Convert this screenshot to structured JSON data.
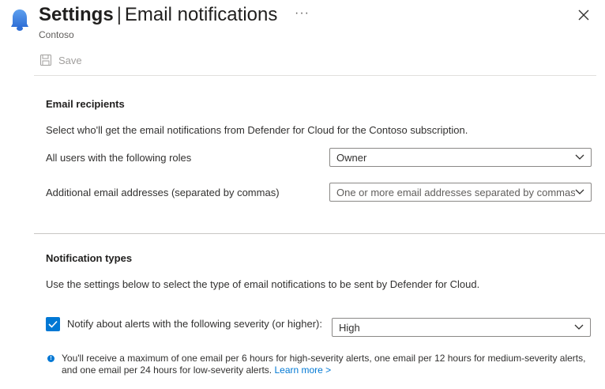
{
  "header": {
    "title_main": "Settings",
    "title_separator": "|",
    "title_sub": "Email notifications",
    "more_label": "···",
    "subtitle": "Contoso"
  },
  "toolbar": {
    "save_label": "Save"
  },
  "recipients": {
    "heading": "Email recipients",
    "description": "Select who'll get the email notifications from Defender for Cloud for the Contoso subscription.",
    "roles_label": "All users with the following roles",
    "roles_value": "Owner",
    "additional_label": "Additional email addresses (separated by commas)",
    "additional_placeholder": "One or more email addresses separated by commas"
  },
  "notifications": {
    "heading": "Notification types",
    "description": "Use the settings below to select the type of email notifications to be sent by Defender for Cloud.",
    "alert_checkbox_label": "Notify about alerts with the following severity (or higher):",
    "alert_checked": true,
    "severity_value": "High",
    "info_text": "You'll receive a maximum of one email per 6 hours for high-severity alerts, one email per 12 hours for medium-severity alerts, and one email per 24 hours for low-severity alerts.",
    "learn_more": "Learn more >"
  },
  "colors": {
    "accent": "#0078d4",
    "bell": "#4f8de8"
  },
  "icons": [
    "bell-icon",
    "close-icon",
    "save-icon",
    "chevron-down-icon",
    "checkmark-icon",
    "info-icon"
  ]
}
